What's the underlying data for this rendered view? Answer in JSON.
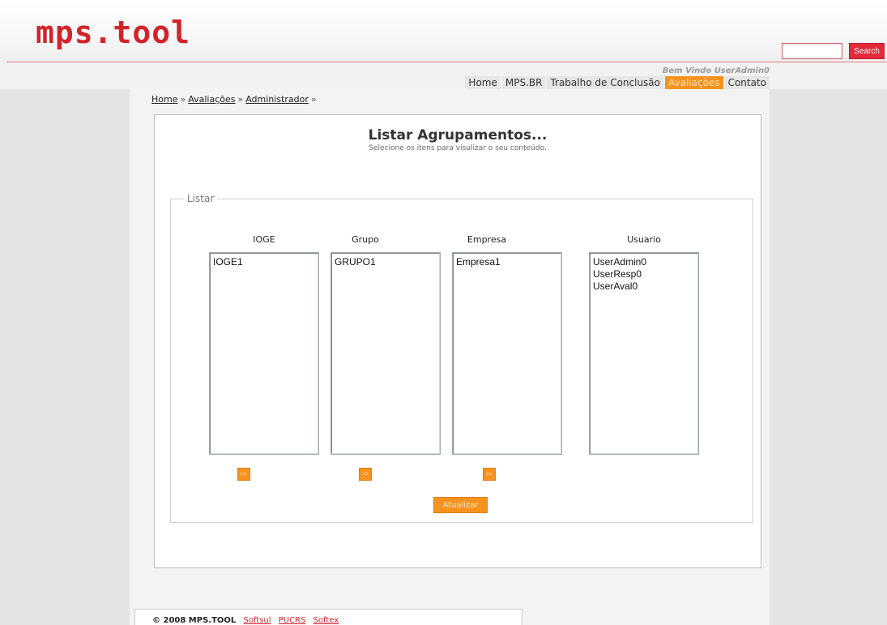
{
  "brand": {
    "logo": "mps.tool"
  },
  "search": {
    "value": "",
    "button_label": "Search"
  },
  "header": {
    "welcome": "Bem Vindo UserAdmin0"
  },
  "nav": {
    "items": [
      {
        "label": "Home"
      },
      {
        "label": "MPS.BR"
      },
      {
        "label": "Trabalho de Conclusão"
      },
      {
        "label": "Avaliações",
        "active": true
      },
      {
        "label": "Contato"
      }
    ]
  },
  "breadcrumb": {
    "items": [
      "Home",
      "Avaliações",
      "Administrador"
    ],
    "separator": "»"
  },
  "page": {
    "title": "Listar Agrupamentos...",
    "subtitle": "Selecione os itens para visulizar o seu conteúdo."
  },
  "fieldset": {
    "legend": "Listar"
  },
  "lists": {
    "ioge": {
      "label": "IOGE",
      "options": [
        "IOGE1"
      ]
    },
    "grupo": {
      "label": "Grupo",
      "options": [
        "GRUPO1"
      ]
    },
    "empresa": {
      "label": "Empresa",
      "options": [
        "Empresa1"
      ]
    },
    "usuario": {
      "label": "Usuario",
      "options": [
        "UserAdmin0",
        "UserResp0",
        "UserAval0"
      ]
    }
  },
  "buttons": {
    "move_label": ">>",
    "update_label": "Atualizar"
  },
  "footer": {
    "copyright": "© 2008 MPS.TOOL",
    "links": [
      "Softsul",
      "PUCRS",
      "Softex"
    ]
  },
  "colors": {
    "brand_red": "#d3232a",
    "accent_orange": "#f6921e",
    "search_red": "#e12a3a"
  }
}
